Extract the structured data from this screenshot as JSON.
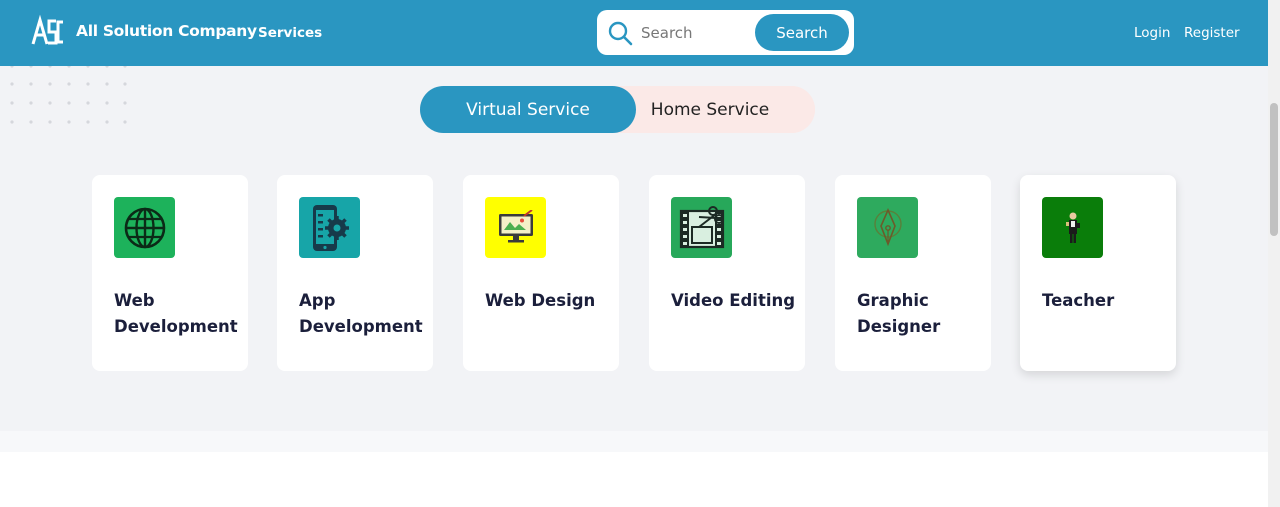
{
  "header": {
    "logo_text": "ASC",
    "brand": "All Solution Company",
    "services_link": "Services",
    "search_placeholder": "Search",
    "search_button": "Search",
    "login": "Login",
    "register": "Register",
    "color": "#2a96c1"
  },
  "toggle": {
    "virtual": "Virtual Service",
    "home": "Home Service",
    "active": "Virtual Service"
  },
  "services": [
    {
      "title": "Web Development",
      "icon": "globe-icon",
      "icon_bg": "#1db25b"
    },
    {
      "title": "App Development",
      "icon": "mobile-gear-icon",
      "icon_bg": "#17a5a8"
    },
    {
      "title": "Web Design",
      "icon": "monitor-design-icon",
      "icon_bg": "#ffff00"
    },
    {
      "title": "Video Editing",
      "icon": "film-scissors-icon",
      "icon_bg": "#27a85a"
    },
    {
      "title": "Graphic Designer",
      "icon": "pen-nib-icon",
      "icon_bg": "#2eaa5e"
    },
    {
      "title": "Teacher",
      "icon": "teacher-icon",
      "icon_bg": "#0a7d0a"
    }
  ]
}
